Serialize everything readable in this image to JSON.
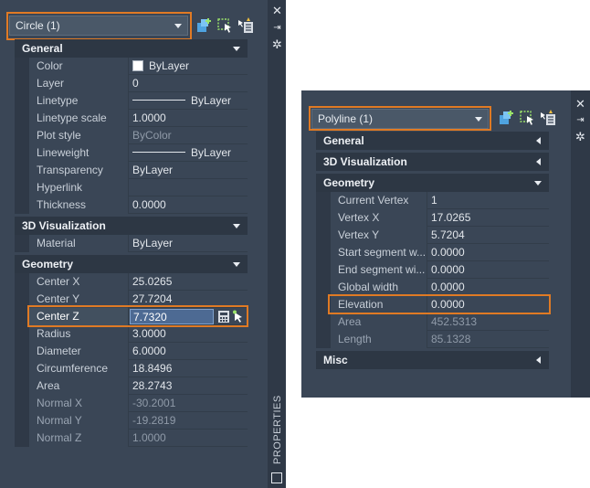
{
  "left_panel": {
    "selector": "Circle (1)",
    "title_vertical": "PROPERTIES",
    "general": {
      "title": "General",
      "rows": [
        {
          "label": "Color",
          "value": "ByLayer"
        },
        {
          "label": "Layer",
          "value": "0"
        },
        {
          "label": "Linetype",
          "value": "ByLayer"
        },
        {
          "label": "Linetype scale",
          "value": "1.0000"
        },
        {
          "label": "Plot style",
          "value": "ByColor"
        },
        {
          "label": "Lineweight",
          "value": "ByLayer"
        },
        {
          "label": "Transparency",
          "value": "ByLayer"
        },
        {
          "label": "Hyperlink",
          "value": ""
        },
        {
          "label": "Thickness",
          "value": "0.0000"
        }
      ]
    },
    "visualization": {
      "title": "3D Visualization",
      "rows": [
        {
          "label": "Material",
          "value": "ByLayer"
        }
      ]
    },
    "geometry": {
      "title": "Geometry",
      "rows": [
        {
          "label": "Center X",
          "value": "25.0265"
        },
        {
          "label": "Center Y",
          "value": "27.7204"
        },
        {
          "label": "Center Z",
          "value": "7.7320"
        },
        {
          "label": "Radius",
          "value": "3.0000"
        },
        {
          "label": "Diameter",
          "value": "6.0000"
        },
        {
          "label": "Circumference",
          "value": "18.8496"
        },
        {
          "label": "Area",
          "value": "28.2743"
        },
        {
          "label": "Normal X",
          "value": "-30.2001"
        },
        {
          "label": "Normal Y",
          "value": "-19.2819"
        },
        {
          "label": "Normal Z",
          "value": "1.0000"
        }
      ]
    }
  },
  "right_panel": {
    "selector": "Polyline (1)",
    "sections": {
      "general": "General",
      "visualization": "3D Visualization",
      "geometry": "Geometry",
      "misc": "Misc"
    },
    "geometry_rows": [
      {
        "label": "Current Vertex",
        "value": "1"
      },
      {
        "label": "Vertex X",
        "value": "17.0265"
      },
      {
        "label": "Vertex Y",
        "value": "5.7204"
      },
      {
        "label": "Start segment w...",
        "value": "0.0000"
      },
      {
        "label": "End segment wi...",
        "value": "0.0000"
      },
      {
        "label": "Global width",
        "value": "0.0000"
      },
      {
        "label": "Elevation",
        "value": "0.0000"
      },
      {
        "label": "Area",
        "value": "452.5313"
      },
      {
        "label": "Length",
        "value": "85.1328"
      }
    ]
  },
  "colors": {
    "highlight": "#e07a24",
    "panel_bg": "#3a4656",
    "section_bg": "#2d3744"
  }
}
